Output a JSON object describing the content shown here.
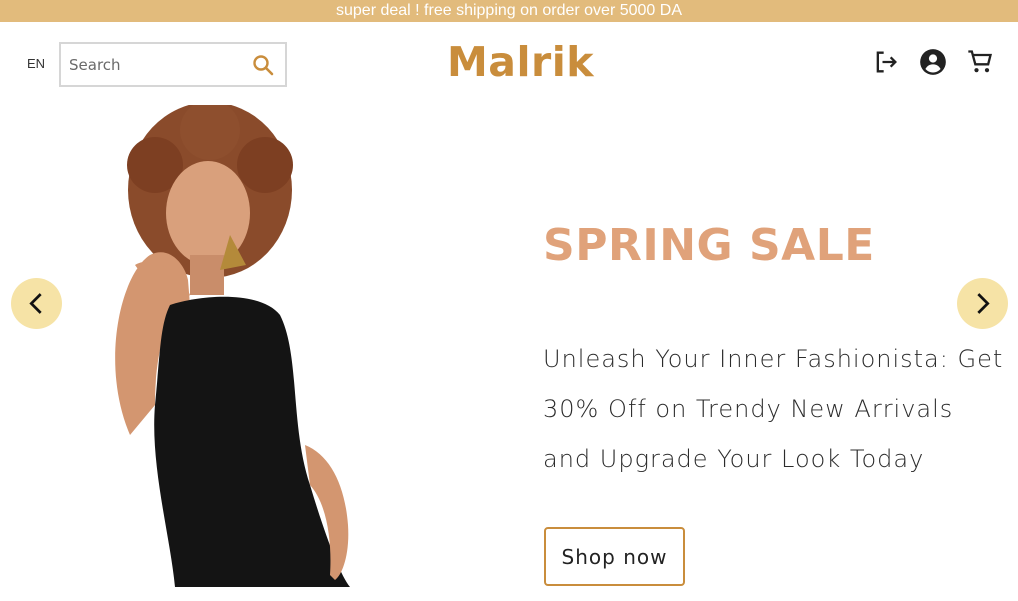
{
  "promo": {
    "text": "super deal ! free shipping on order over 5000 DA"
  },
  "header": {
    "language": "EN",
    "search": {
      "placeholder": "Search",
      "value": ""
    },
    "logo": "Malrik",
    "icons": [
      "logout-icon",
      "account-icon",
      "cart-icon"
    ]
  },
  "hero": {
    "title": "SPRING SALE",
    "lines": [
      "Unleash Your Inner Fashionista: Get",
      "30% Off on Trendy New Arrivals",
      "and Upgrade Your Look Today"
    ],
    "cta": "Shop now",
    "prev_icon": "chevron-left-icon",
    "next_icon": "chevron-right-icon"
  },
  "colors": {
    "promo_bg": "#e2bb7c",
    "brand": "#c98d3c",
    "sale_title": "#e0a27a",
    "arrow_bg": "#f6e3a6"
  }
}
